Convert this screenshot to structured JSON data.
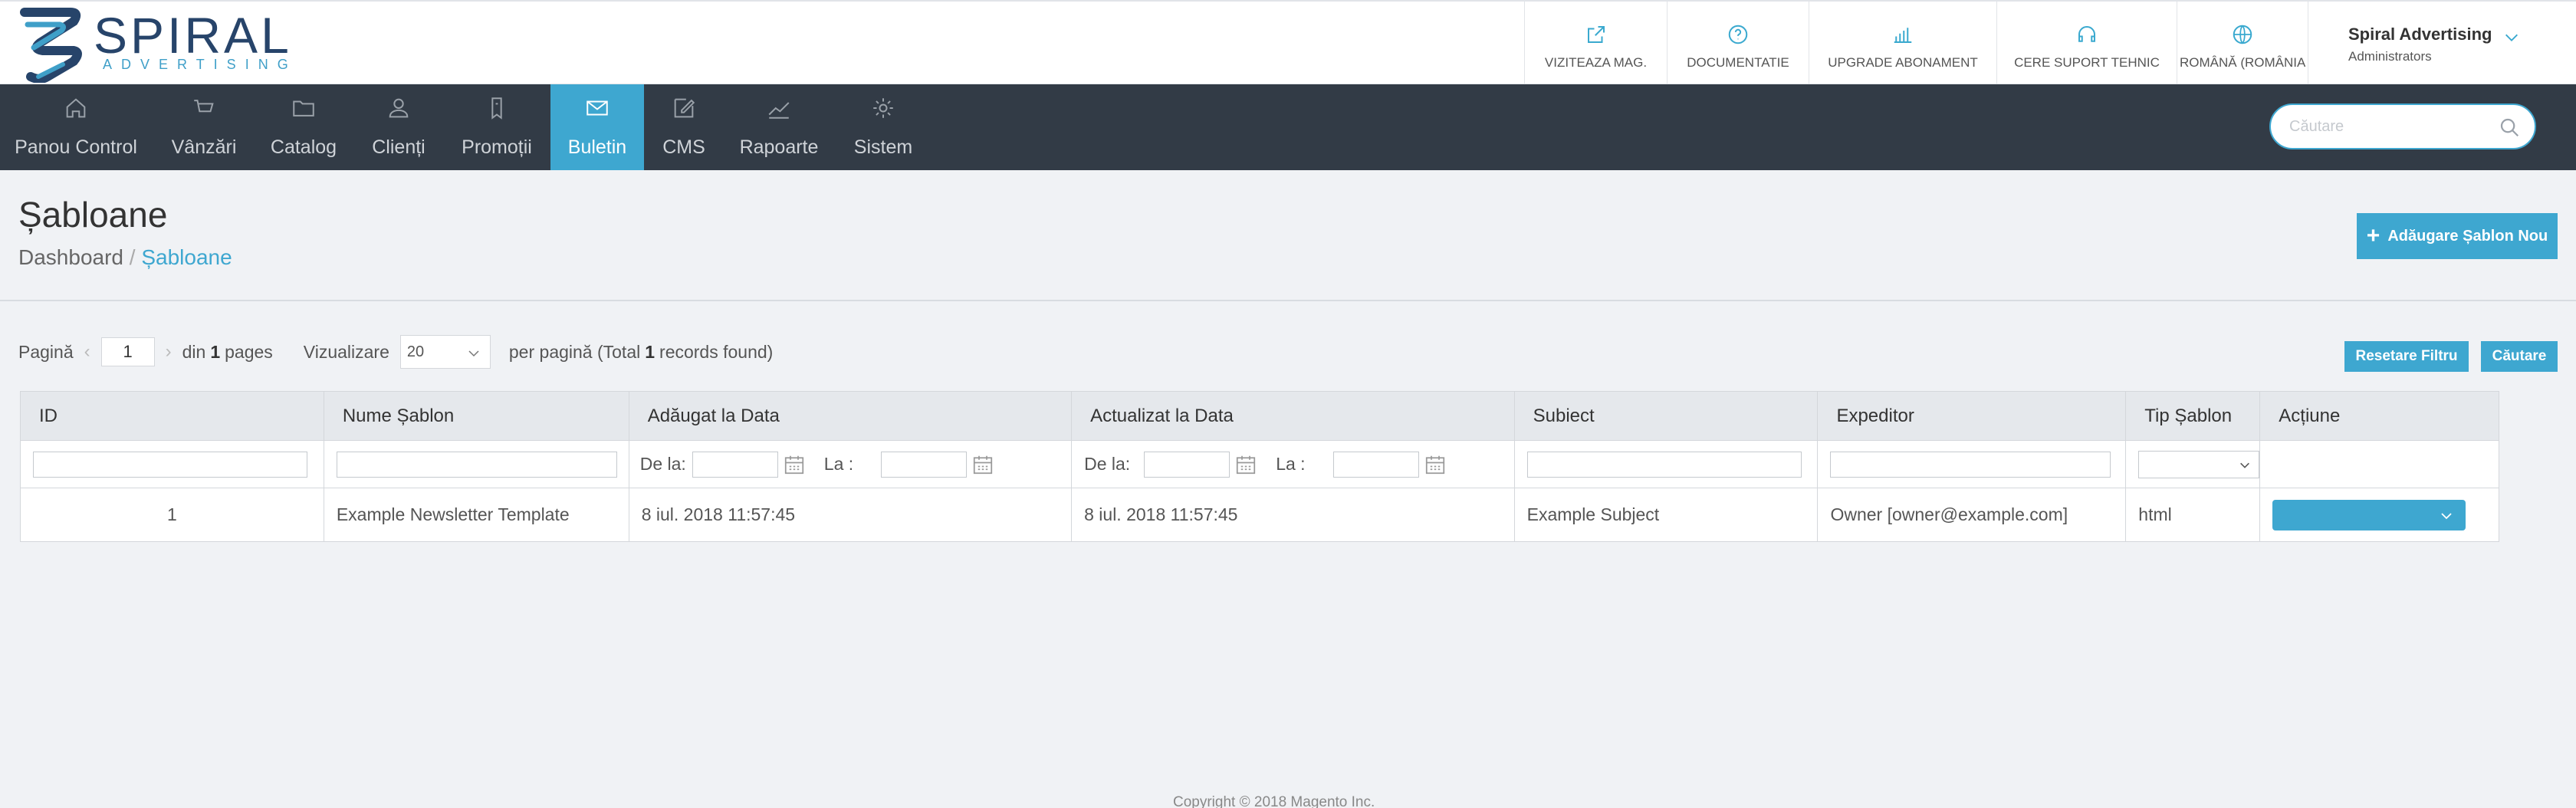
{
  "brand": {
    "name": "SPIRAL",
    "tagline": "ADVERTISING",
    "colors": {
      "dark": "#27446a",
      "accent": "#3ea7d0",
      "nav_bg": "#323b46",
      "page_bg": "#f0f2f5"
    }
  },
  "header": {
    "links": [
      {
        "label": "VIZITEAZA MAG.",
        "icon": "external-link-icon"
      },
      {
        "label": "DOCUMENTATIE",
        "icon": "question-circle-icon"
      },
      {
        "label": "UPGRADE ABONAMENT",
        "icon": "bar-chart-icon"
      },
      {
        "label": "CERE SUPORT TEHNIC",
        "icon": "headset-icon"
      },
      {
        "label": "ROMÂNĂ (ROMÂNIA)",
        "icon": "globe-icon"
      }
    ],
    "user": {
      "name": "Spiral Advertising",
      "role": "Administrators"
    }
  },
  "nav": {
    "items": [
      {
        "label": "Panou Control",
        "icon": "home-icon"
      },
      {
        "label": "Vânzări",
        "icon": "cart-icon"
      },
      {
        "label": "Catalog",
        "icon": "folder-icon"
      },
      {
        "label": "Clienți",
        "icon": "user-icon"
      },
      {
        "label": "Promoții",
        "icon": "tag-icon"
      },
      {
        "label": "Buletin",
        "icon": "envelope-icon",
        "active": true
      },
      {
        "label": "CMS",
        "icon": "edit-icon"
      },
      {
        "label": "Rapoarte",
        "icon": "line-chart-icon"
      },
      {
        "label": "Sistem",
        "icon": "gear-icon"
      }
    ],
    "search_placeholder": "Căutare"
  },
  "page": {
    "title": "Șabloane",
    "breadcrumb": [
      "Dashboard",
      "Șabloane"
    ],
    "add_button": "Adăugare Șablon Nou"
  },
  "pager": {
    "page_label": "Pagină",
    "page_value": "1",
    "of_label": "din",
    "total_pages": "1",
    "pages_label": "pages",
    "view_label": "Vizualizare",
    "per_page": "20",
    "per_page_label": "per pagină (Total",
    "total_records": "1",
    "records_label": "records found)",
    "reset_button": "Resetare Filtru",
    "search_button": "Căutare"
  },
  "table": {
    "columns": [
      "ID",
      "Nume Șablon",
      "Adăugat la Data",
      "Actualizat la Data",
      "Subiect",
      "Expeditor",
      "Tip Șablon",
      "Acțiune"
    ],
    "date_from": "De la:",
    "date_to": "La :",
    "rows": [
      {
        "id": "1",
        "name": "Example Newsletter Template",
        "added": "8 iul. 2018 11:57:45",
        "updated": "8 iul. 2018 11:57:45",
        "subject": "Example Subject",
        "sender": "Owner [owner@example.com]",
        "type": "html"
      }
    ]
  },
  "footer": {
    "copyright": "Copyright © 2018 Magento Inc."
  }
}
